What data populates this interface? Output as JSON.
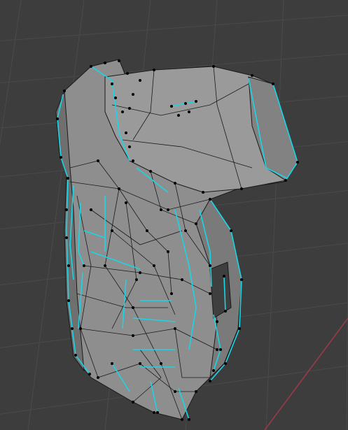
{
  "viewport": {
    "mode": "edit-mode",
    "background": "#3d3d3d",
    "grid_color": "#4a4a4a",
    "axis_x_color": "#9e3a48",
    "mesh_face_color": "#8e8e8e",
    "mesh_shade_color": "#6f6f6f",
    "mesh_edge_color": "#1a1a1a",
    "seam_color": "#19d6e6",
    "vertex_color": "#000000"
  }
}
